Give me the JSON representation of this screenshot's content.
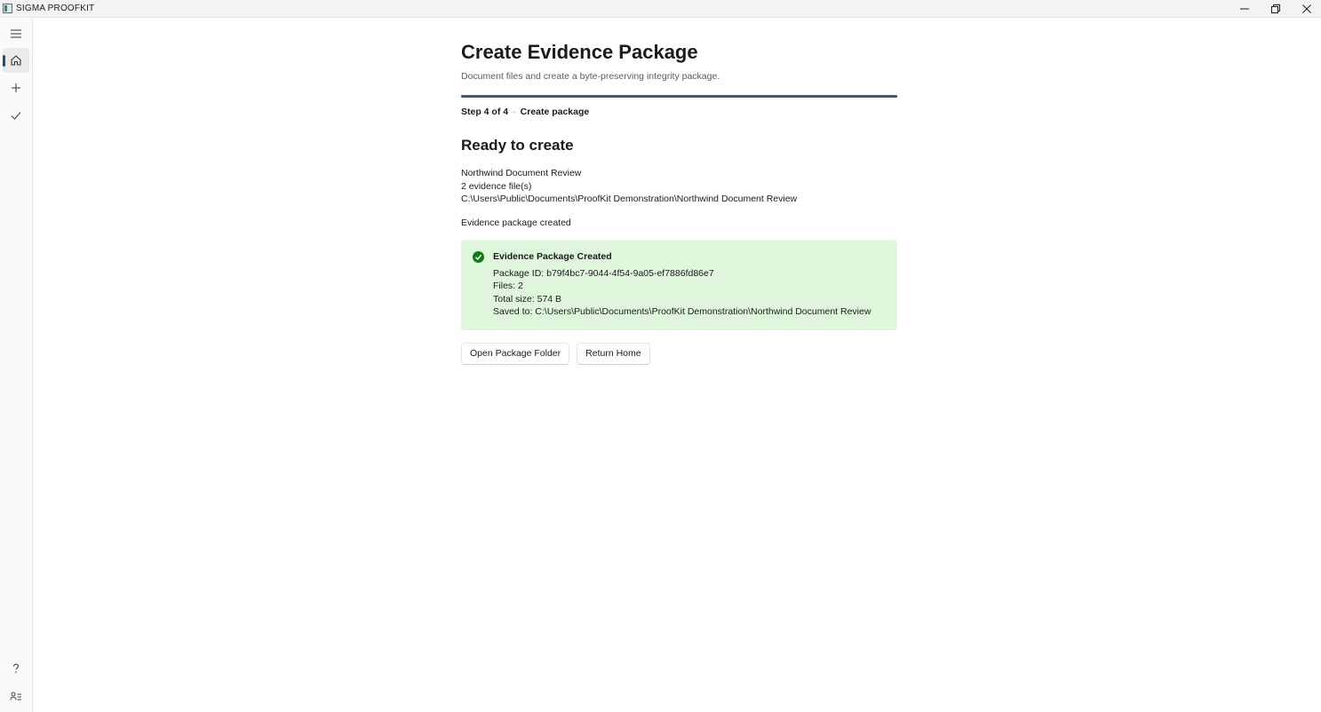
{
  "window": {
    "title": "SIGMA PROOFKIT",
    "controls": [
      "minimize-icon",
      "restore-icon",
      "close-icon"
    ]
  },
  "sidebar": {
    "items": [
      {
        "icon": "hamburger-menu-icon"
      },
      {
        "icon": "home-icon",
        "selected": true
      },
      {
        "icon": "plus-icon"
      },
      {
        "icon": "checkmark-icon"
      }
    ],
    "footer_items": [
      {
        "icon": "help-icon"
      },
      {
        "icon": "settings-icon"
      }
    ]
  },
  "header": {
    "title": "Create Evidence Package",
    "subtitle": "Document files and create a byte-preserving integrity package."
  },
  "progress": {
    "fraction": 1.0
  },
  "step": {
    "label": "Step 4 of 4",
    "separator": "·",
    "name": "Create package"
  },
  "main": {
    "section_title": "Ready to create",
    "summary": {
      "case_name": "Northwind Document Review",
      "file_count": "2 evidence file(s)",
      "path": "C:\\Users\\Public\\Documents\\ProofKit Demonstration\\Northwind Document Review"
    },
    "status": "Evidence package created"
  },
  "result": {
    "title": "Evidence Package Created",
    "package_id": "Package ID: b79f4bc7-9044-4f54-9a05-ef7886fd86e7",
    "files": "Files: 2",
    "total_size": "Total size: 574 B",
    "saved_to": "Saved to: C:\\Users\\Public\\Documents\\ProofKit Demonstration\\Northwind Document Review"
  },
  "actions": {
    "open_folder": "Open Package Folder",
    "return_home": "Return Home"
  },
  "colors": {
    "accent": "#1f4e79",
    "progress": "#3a5a78",
    "success_bg": "#dff6dd",
    "success_icon": "#107c10"
  }
}
